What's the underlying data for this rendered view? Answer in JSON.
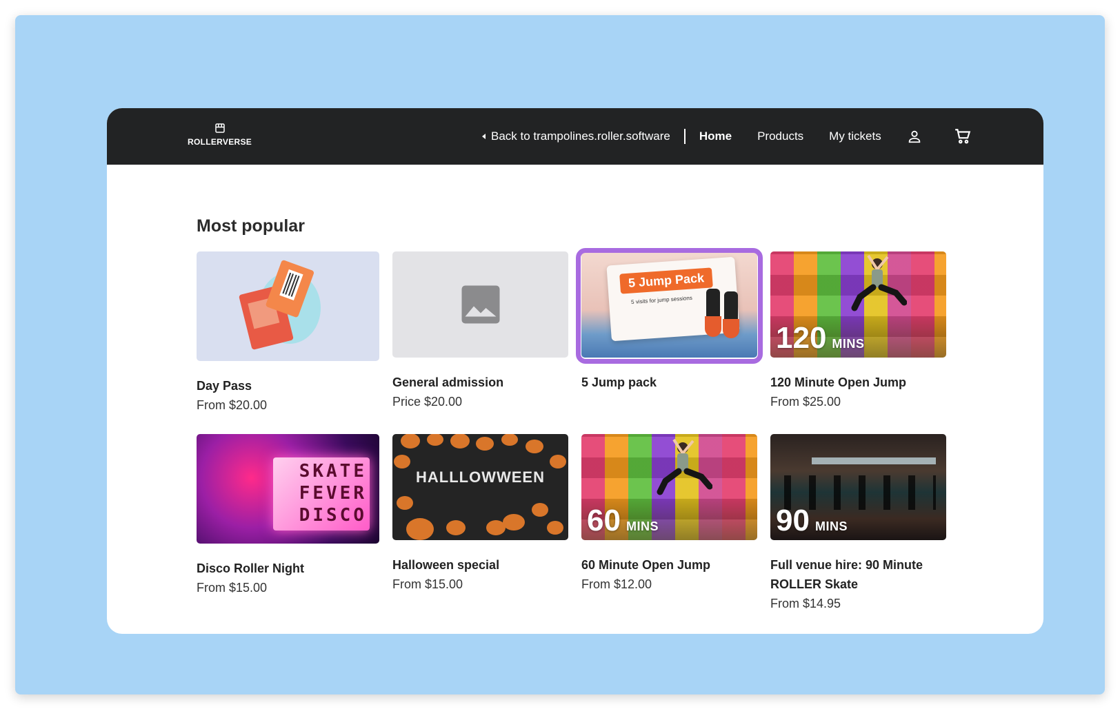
{
  "brand": {
    "name": "ROLLERVERSE",
    "icon": "storefront-icon"
  },
  "nav": {
    "back_label": "Back to trampolines.roller.software",
    "home": "Home",
    "products": "Products",
    "my_tickets": "My tickets",
    "account_icon": "user-icon",
    "cart_icon": "cart-icon"
  },
  "section": {
    "title": "Most popular"
  },
  "products": [
    {
      "title": "Day Pass",
      "price": "From $20.00"
    },
    {
      "title": "General admission",
      "price": "Price $20.00",
      "image_icon": "image-placeholder-icon"
    },
    {
      "title": "5 Jump pack",
      "banner": "5 Jump Pack",
      "banner_sub": "5 visits for jump sessions"
    },
    {
      "title": "120 Minute Open Jump",
      "price": "From $25.00",
      "badge_num": "120",
      "badge_unit": "MINS"
    },
    {
      "title": "Disco Roller Night",
      "price": "From $15.00",
      "sign": [
        "SKATE",
        "FEVER",
        "DISCO"
      ]
    },
    {
      "title": "Halloween special",
      "price": "From $15.00",
      "image_text": "HALLLOWWEEN"
    },
    {
      "title": "60 Minute Open Jump",
      "price": "From $12.00",
      "badge_num": "60",
      "badge_unit": "MINS"
    },
    {
      "title": "Full venue hire: 90 Minute ROLLER Skate",
      "price": "From $14.95",
      "badge_num": "90",
      "badge_unit": "MINS"
    }
  ],
  "colors": {
    "nav_bg": "#222324",
    "page_bg": "#a8d4f6",
    "selected_ring": "#a86be0",
    "placeholder_bg": "#e3e3e6"
  }
}
